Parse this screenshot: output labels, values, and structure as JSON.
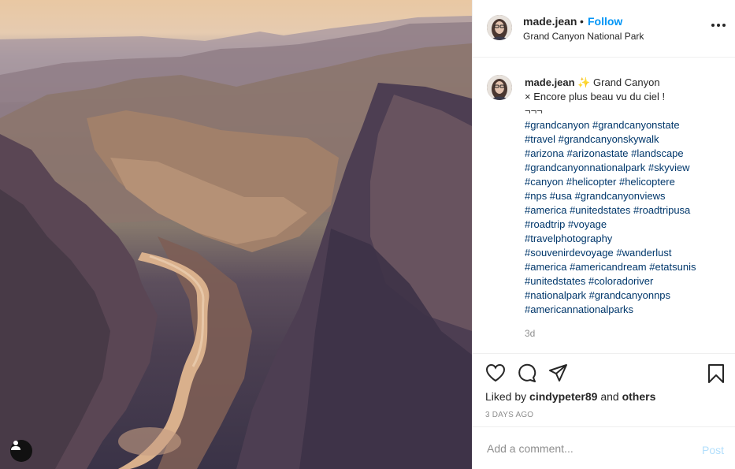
{
  "post": {
    "username": "made.jean",
    "separator": "•",
    "follow_label": "Follow",
    "location": "Grand Canyon National Park"
  },
  "caption": {
    "username": "made.jean",
    "sparkle": "✨",
    "title": "Grand Canyon",
    "line1": "× Encore plus beau vu du ciel !",
    "line2": "¬¬¬",
    "hashtag_lines": [
      "#grandcanyon #grandcanyonstate",
      "#travel #grandcanyonskywalk",
      "#arizona #arizonastate #landscape",
      "#grandcanyonnationalpark #skyview",
      "#canyon #helicopter #helicoptere",
      "#nps #usa #grandcanyonviews",
      "#america #unitedstates #roadtripusa",
      "#roadtrip #voyage",
      "#travelphotography",
      "#souvenirdevoyage #wanderlust",
      "#america #americandream #etatsunis",
      "#unitedstates #coloradoriver",
      "#nationalpark #grandcanyonnps",
      "#americannationalparks"
    ],
    "time": "3d"
  },
  "actions": {
    "icons": [
      "heart-icon",
      "comment-icon",
      "share-icon",
      "bookmark-icon"
    ],
    "liked_by_prefix": "Liked by",
    "liked_by_user": "cindypeter89",
    "liked_by_and": "and",
    "liked_by_others": "others",
    "time_ago": "3 days ago"
  },
  "comment": {
    "placeholder": "Add a comment...",
    "post_label": "Post"
  },
  "colors": {
    "link_blue": "#0095f6",
    "hashtag": "#00376b",
    "post_disabled": "#b2dffc",
    "muted": "#8e8e8e"
  }
}
